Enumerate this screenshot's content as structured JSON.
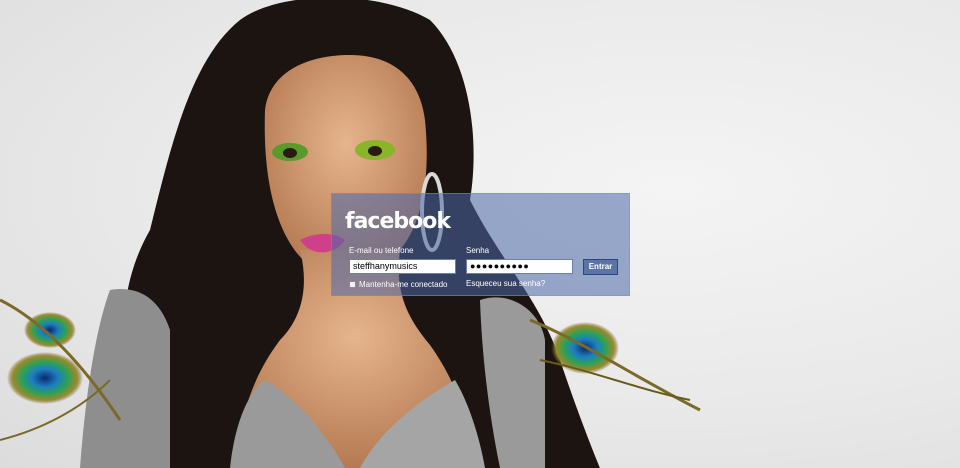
{
  "brand": {
    "logo_text": "facebook"
  },
  "login_form": {
    "email_label": "E-mail ou telefone",
    "email_value": "steffhanymusics",
    "password_label": "Senha",
    "password_value": "●●●●●●●●●●",
    "submit_label": "Entrar",
    "remember_label": "Mantenha-me conectado",
    "forgot_label": "Esqueceu sua senha?"
  },
  "colors": {
    "panel_bg": "#4a67a7",
    "button_bg": "#5b74a8",
    "button_border": "#2d4486",
    "text": "#ffffff",
    "background": "#e9e9e9"
  },
  "icons": {
    "remember_checkbox": "checkbox-icon"
  }
}
